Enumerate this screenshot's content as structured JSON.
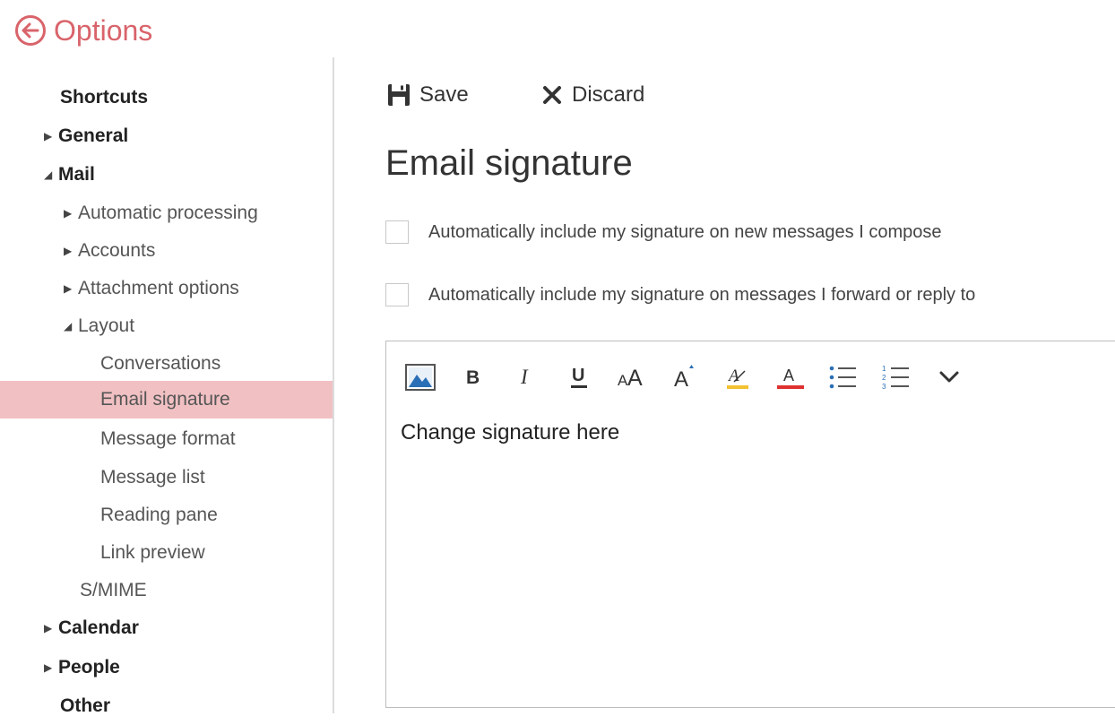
{
  "header": {
    "title": "Options"
  },
  "sidebar": {
    "items": [
      {
        "label": "Shortcuts",
        "level": "top",
        "caret": ""
      },
      {
        "label": "General",
        "level": "top",
        "caret": "right"
      },
      {
        "label": "Mail",
        "level": "top",
        "caret": "down"
      },
      {
        "label": "Automatic processing",
        "level": "sub",
        "caret": "right"
      },
      {
        "label": "Accounts",
        "level": "sub",
        "caret": "right"
      },
      {
        "label": "Attachment options",
        "level": "sub",
        "caret": "right"
      },
      {
        "label": "Layout",
        "level": "sub",
        "caret": "down"
      },
      {
        "label": "Conversations",
        "level": "leaf",
        "caret": ""
      },
      {
        "label": "Email signature",
        "level": "leaf",
        "caret": "",
        "selected": true
      },
      {
        "label": "Message format",
        "level": "leaf",
        "caret": ""
      },
      {
        "label": "Message list",
        "level": "leaf",
        "caret": ""
      },
      {
        "label": "Reading pane",
        "level": "leaf",
        "caret": ""
      },
      {
        "label": "Link preview",
        "level": "leaf",
        "caret": ""
      },
      {
        "label": "S/MIME",
        "level": "sub",
        "caret": ""
      },
      {
        "label": "Calendar",
        "level": "top",
        "caret": "right"
      },
      {
        "label": "People",
        "level": "top",
        "caret": "right"
      },
      {
        "label": "Other",
        "level": "top",
        "caret": ""
      }
    ]
  },
  "toolbar": {
    "save_label": "Save",
    "discard_label": "Discard"
  },
  "main": {
    "title": "Email signature",
    "checkboxes": [
      {
        "label": "Automatically include my signature on new messages I compose",
        "checked": false
      },
      {
        "label": "Automatically include my signature on messages I forward or reply to",
        "checked": false
      }
    ],
    "editor": {
      "content": "Change signature here",
      "tools": [
        "insert-picture-icon",
        "bold-icon",
        "italic-icon",
        "underline-icon",
        "font-size-icon",
        "grow-font-icon",
        "highlight-icon",
        "font-color-icon",
        "bullets-icon",
        "numbering-icon",
        "more-options-icon"
      ]
    }
  },
  "colors": {
    "accent": "#d9646b",
    "selected": "#f1c0c3",
    "highlight": "#f2c231",
    "font_color": "#e03030",
    "picture_blue": "#2b6fb6"
  }
}
